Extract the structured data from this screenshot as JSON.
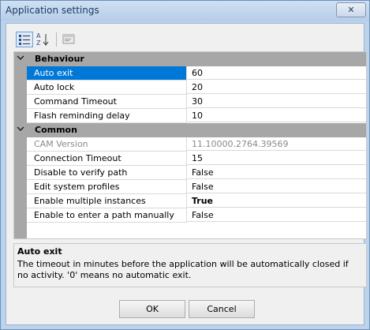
{
  "window": {
    "title": "Application settings",
    "close_glyph": "✕"
  },
  "toolbar": {
    "categorized_icon": "categorized-view-icon",
    "alphabetical_icon": "sort-az-icon",
    "pages_icon": "property-pages-icon"
  },
  "grid": {
    "categories": [
      {
        "name": "Behaviour",
        "properties": [
          {
            "name": "Auto exit",
            "value": "60",
            "selected": true
          },
          {
            "name": "Auto lock",
            "value": "20"
          },
          {
            "name": "Command Timeout",
            "value": "30"
          },
          {
            "name": "Flash reminding delay",
            "value": "10"
          }
        ]
      },
      {
        "name": "Common",
        "properties": [
          {
            "name": "CAM Version",
            "value": "11.10000.2764.39569",
            "readonly": true
          },
          {
            "name": "Connection Timeout",
            "value": "15"
          },
          {
            "name": "Disable to verify path",
            "value": "False"
          },
          {
            "name": "Edit system profiles",
            "value": "False"
          },
          {
            "name": "Enable multiple instances",
            "value": "True",
            "bold": true
          },
          {
            "name": "Enable to enter a path manually",
            "value": "False"
          }
        ]
      }
    ]
  },
  "description": {
    "title": "Auto exit",
    "text": "The timeout in minutes before  the application will be automatically closed if no activity. '0' means no automatic exit."
  },
  "buttons": {
    "ok": "OK",
    "cancel": "Cancel"
  },
  "colors": {
    "selection": "#0078d7",
    "category_band": "#a7a7a7",
    "frame": "#bcd3ec"
  }
}
